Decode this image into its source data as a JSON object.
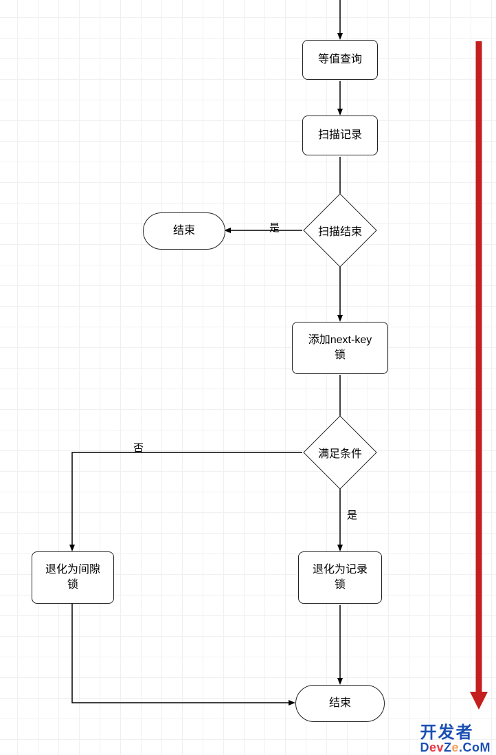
{
  "nodes": {
    "equal_query": "等值查询",
    "scan_record": "扫描记录",
    "scan_end": "扫描结束",
    "end1": "结束",
    "add_nextkey": "添加next-key\n锁",
    "cond": "满足条件",
    "gap_lock": "退化为间隙\n锁",
    "record_lock": "退化为记录\n锁",
    "end2": "结束"
  },
  "edges": {
    "yes1": "是",
    "yes2": "是",
    "no": "否"
  },
  "watermark": {
    "line1": "开发者",
    "prefix": "D",
    "mid": "ev",
    "suffix1": "Z",
    "dot": "e",
    "suffix2": ".CoM"
  }
}
